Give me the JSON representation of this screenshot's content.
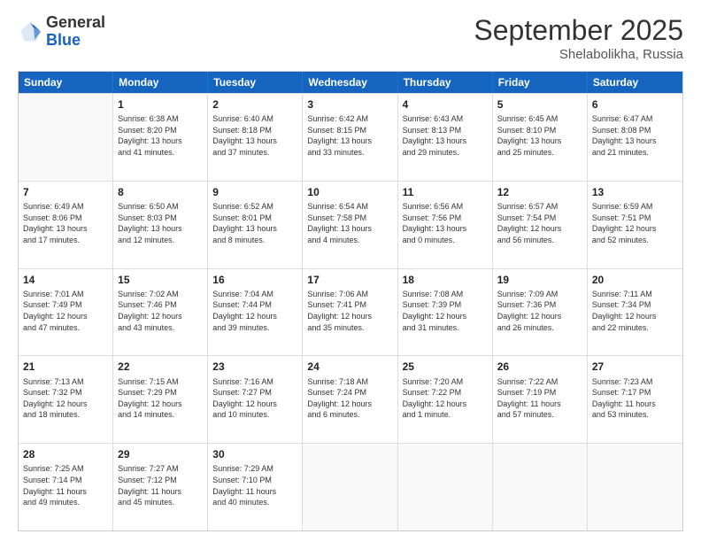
{
  "header": {
    "logo_general": "General",
    "logo_blue": "Blue",
    "month": "September 2025",
    "location": "Shelabolikha, Russia"
  },
  "days_of_week": [
    "Sunday",
    "Monday",
    "Tuesday",
    "Wednesday",
    "Thursday",
    "Friday",
    "Saturday"
  ],
  "rows": [
    [
      {
        "day": "",
        "info": ""
      },
      {
        "day": "1",
        "info": "Sunrise: 6:38 AM\nSunset: 8:20 PM\nDaylight: 13 hours\nand 41 minutes."
      },
      {
        "day": "2",
        "info": "Sunrise: 6:40 AM\nSunset: 8:18 PM\nDaylight: 13 hours\nand 37 minutes."
      },
      {
        "day": "3",
        "info": "Sunrise: 6:42 AM\nSunset: 8:15 PM\nDaylight: 13 hours\nand 33 minutes."
      },
      {
        "day": "4",
        "info": "Sunrise: 6:43 AM\nSunset: 8:13 PM\nDaylight: 13 hours\nand 29 minutes."
      },
      {
        "day": "5",
        "info": "Sunrise: 6:45 AM\nSunset: 8:10 PM\nDaylight: 13 hours\nand 25 minutes."
      },
      {
        "day": "6",
        "info": "Sunrise: 6:47 AM\nSunset: 8:08 PM\nDaylight: 13 hours\nand 21 minutes."
      }
    ],
    [
      {
        "day": "7",
        "info": "Sunrise: 6:49 AM\nSunset: 8:06 PM\nDaylight: 13 hours\nand 17 minutes."
      },
      {
        "day": "8",
        "info": "Sunrise: 6:50 AM\nSunset: 8:03 PM\nDaylight: 13 hours\nand 12 minutes."
      },
      {
        "day": "9",
        "info": "Sunrise: 6:52 AM\nSunset: 8:01 PM\nDaylight: 13 hours\nand 8 minutes."
      },
      {
        "day": "10",
        "info": "Sunrise: 6:54 AM\nSunset: 7:58 PM\nDaylight: 13 hours\nand 4 minutes."
      },
      {
        "day": "11",
        "info": "Sunrise: 6:56 AM\nSunset: 7:56 PM\nDaylight: 13 hours\nand 0 minutes."
      },
      {
        "day": "12",
        "info": "Sunrise: 6:57 AM\nSunset: 7:54 PM\nDaylight: 12 hours\nand 56 minutes."
      },
      {
        "day": "13",
        "info": "Sunrise: 6:59 AM\nSunset: 7:51 PM\nDaylight: 12 hours\nand 52 minutes."
      }
    ],
    [
      {
        "day": "14",
        "info": "Sunrise: 7:01 AM\nSunset: 7:49 PM\nDaylight: 12 hours\nand 47 minutes."
      },
      {
        "day": "15",
        "info": "Sunrise: 7:02 AM\nSunset: 7:46 PM\nDaylight: 12 hours\nand 43 minutes."
      },
      {
        "day": "16",
        "info": "Sunrise: 7:04 AM\nSunset: 7:44 PM\nDaylight: 12 hours\nand 39 minutes."
      },
      {
        "day": "17",
        "info": "Sunrise: 7:06 AM\nSunset: 7:41 PM\nDaylight: 12 hours\nand 35 minutes."
      },
      {
        "day": "18",
        "info": "Sunrise: 7:08 AM\nSunset: 7:39 PM\nDaylight: 12 hours\nand 31 minutes."
      },
      {
        "day": "19",
        "info": "Sunrise: 7:09 AM\nSunset: 7:36 PM\nDaylight: 12 hours\nand 26 minutes."
      },
      {
        "day": "20",
        "info": "Sunrise: 7:11 AM\nSunset: 7:34 PM\nDaylight: 12 hours\nand 22 minutes."
      }
    ],
    [
      {
        "day": "21",
        "info": "Sunrise: 7:13 AM\nSunset: 7:32 PM\nDaylight: 12 hours\nand 18 minutes."
      },
      {
        "day": "22",
        "info": "Sunrise: 7:15 AM\nSunset: 7:29 PM\nDaylight: 12 hours\nand 14 minutes."
      },
      {
        "day": "23",
        "info": "Sunrise: 7:16 AM\nSunset: 7:27 PM\nDaylight: 12 hours\nand 10 minutes."
      },
      {
        "day": "24",
        "info": "Sunrise: 7:18 AM\nSunset: 7:24 PM\nDaylight: 12 hours\nand 6 minutes."
      },
      {
        "day": "25",
        "info": "Sunrise: 7:20 AM\nSunset: 7:22 PM\nDaylight: 12 hours\nand 1 minute."
      },
      {
        "day": "26",
        "info": "Sunrise: 7:22 AM\nSunset: 7:19 PM\nDaylight: 11 hours\nand 57 minutes."
      },
      {
        "day": "27",
        "info": "Sunrise: 7:23 AM\nSunset: 7:17 PM\nDaylight: 11 hours\nand 53 minutes."
      }
    ],
    [
      {
        "day": "28",
        "info": "Sunrise: 7:25 AM\nSunset: 7:14 PM\nDaylight: 11 hours\nand 49 minutes."
      },
      {
        "day": "29",
        "info": "Sunrise: 7:27 AM\nSunset: 7:12 PM\nDaylight: 11 hours\nand 45 minutes."
      },
      {
        "day": "30",
        "info": "Sunrise: 7:29 AM\nSunset: 7:10 PM\nDaylight: 11 hours\nand 40 minutes."
      },
      {
        "day": "",
        "info": ""
      },
      {
        "day": "",
        "info": ""
      },
      {
        "day": "",
        "info": ""
      },
      {
        "day": "",
        "info": ""
      }
    ]
  ]
}
